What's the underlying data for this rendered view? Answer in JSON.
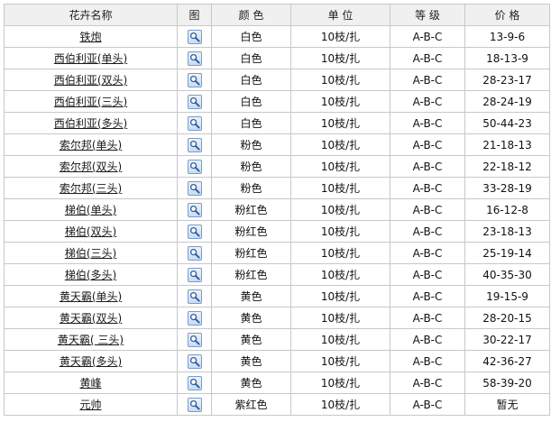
{
  "headers": [
    "花卉名称",
    "图",
    "颜 色",
    "单 位",
    "等 级",
    "价 格"
  ],
  "icon": "magnifier-icon",
  "rows": [
    {
      "name": "铁炮",
      "color": "白色",
      "unit": "10枝/扎",
      "grade": "A-B-C",
      "price": "13-9-6"
    },
    {
      "name": "西伯利亚(单头)",
      "color": "白色",
      "unit": "10枝/扎",
      "grade": "A-B-C",
      "price": "18-13-9"
    },
    {
      "name": "西伯利亚(双头)",
      "color": "白色",
      "unit": "10枝/扎",
      "grade": "A-B-C",
      "price": "28-23-17"
    },
    {
      "name": "西伯利亚(三头)",
      "color": "白色",
      "unit": "10枝/扎",
      "grade": "A-B-C",
      "price": "28-24-19"
    },
    {
      "name": "西伯利亚(多头)",
      "color": "白色",
      "unit": "10枝/扎",
      "grade": "A-B-C",
      "price": "50-44-23"
    },
    {
      "name": "索尔邦(单头)",
      "color": "粉色",
      "unit": "10枝/扎",
      "grade": "A-B-C",
      "price": "21-18-13"
    },
    {
      "name": "索尔邦(双头)",
      "color": "粉色",
      "unit": "10枝/扎",
      "grade": "A-B-C",
      "price": "22-18-12"
    },
    {
      "name": "索尔邦(三头)",
      "color": "粉色",
      "unit": "10枝/扎",
      "grade": "A-B-C",
      "price": "33-28-19"
    },
    {
      "name": "梯伯(单头)",
      "color": "粉红色",
      "unit": "10枝/扎",
      "grade": "A-B-C",
      "price": "16-12-8"
    },
    {
      "name": "梯伯(双头)",
      "color": "粉红色",
      "unit": "10枝/扎",
      "grade": "A-B-C",
      "price": "23-18-13"
    },
    {
      "name": "梯伯(三头)",
      "color": "粉红色",
      "unit": "10枝/扎",
      "grade": "A-B-C",
      "price": "25-19-14"
    },
    {
      "name": "梯伯(多头)",
      "color": "粉红色",
      "unit": "10枝/扎",
      "grade": "A-B-C",
      "price": "40-35-30"
    },
    {
      "name": "黄天霸(单头)",
      "color": "黄色",
      "unit": "10枝/扎",
      "grade": "A-B-C",
      "price": "19-15-9"
    },
    {
      "name": "黄天霸(双头)",
      "color": "黄色",
      "unit": "10枝/扎",
      "grade": "A-B-C",
      "price": "28-20-15"
    },
    {
      "name": "黄天霸( 三头)",
      "color": "黄色",
      "unit": "10枝/扎",
      "grade": "A-B-C",
      "price": "30-22-17"
    },
    {
      "name": "黄天霸(多头)",
      "color": "黄色",
      "unit": "10枝/扎",
      "grade": "A-B-C",
      "price": "42-36-27"
    },
    {
      "name": "黄峰",
      "color": "黄色",
      "unit": "10枝/扎",
      "grade": "A-B-C",
      "price": "58-39-20"
    },
    {
      "name": "元帅",
      "color": "紫红色",
      "unit": "10枝/扎",
      "grade": "A-B-C",
      "price": "暂无"
    }
  ]
}
